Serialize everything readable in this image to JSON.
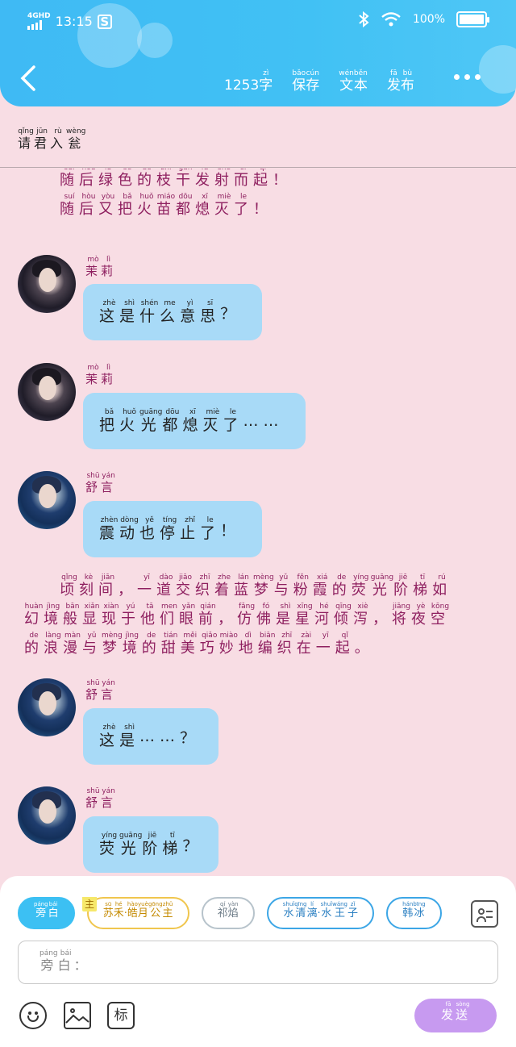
{
  "statusbar": {
    "network": "4GHD",
    "time": "13:15",
    "sim_icon": "S",
    "battery": "100%"
  },
  "header": {
    "word_count": "1253",
    "word_unit": {
      "char": "字",
      "py": "zì"
    },
    "save": [
      {
        "char": "保",
        "py": "bǎo"
      },
      {
        "char": "存",
        "py": "cún"
      }
    ],
    "text": [
      {
        "char": "文",
        "py": "wén"
      },
      {
        "char": "本",
        "py": "běn"
      }
    ],
    "publish": [
      {
        "char": "发",
        "py": "fā"
      },
      {
        "char": "布",
        "py": "bù"
      }
    ]
  },
  "title": [
    {
      "char": "请",
      "py": "qǐng"
    },
    {
      "char": "君",
      "py": "jūn"
    },
    {
      "char": "入",
      "py": "rù"
    },
    {
      "char": "瓮",
      "py": "wèng"
    }
  ],
  "messages": [
    {
      "type": "narration",
      "lines": [
        [
          [
            "随",
            "suí"
          ],
          [
            "后",
            "hòu"
          ],
          [
            "绿",
            "lǜ"
          ],
          [
            "色",
            "sè"
          ],
          [
            "的",
            "de"
          ],
          [
            "枝",
            "zhī"
          ],
          [
            "干",
            "gàn"
          ],
          [
            "发",
            "fā"
          ],
          [
            "射",
            "shè"
          ],
          [
            "而",
            "ér"
          ],
          [
            "起",
            "qǐ"
          ],
          [
            "！",
            ""
          ]
        ],
        [
          [
            "随",
            "suí"
          ],
          [
            "后",
            "hòu"
          ],
          [
            "又",
            "yòu"
          ],
          [
            "把",
            "bǎ"
          ],
          [
            "火",
            "huǒ"
          ],
          [
            "苗",
            "miáo"
          ],
          [
            "都",
            "dōu"
          ],
          [
            "熄",
            "xī"
          ],
          [
            "灭",
            "miè"
          ],
          [
            "了",
            "le"
          ],
          [
            "！",
            ""
          ]
        ]
      ]
    },
    {
      "type": "chat",
      "avatar": "moli",
      "sender": [
        [
          "茉",
          "mò"
        ],
        [
          "莉",
          "lì"
        ]
      ],
      "text": [
        [
          "这",
          "zhè"
        ],
        [
          "是",
          "shì"
        ],
        [
          "什",
          "shén"
        ],
        [
          "么",
          "me"
        ],
        [
          "意",
          "yì"
        ],
        [
          "思",
          "sī"
        ],
        [
          "？",
          ""
        ]
      ]
    },
    {
      "type": "chat",
      "avatar": "moli",
      "sender": [
        [
          "茉",
          "mò"
        ],
        [
          "莉",
          "lì"
        ]
      ],
      "text": [
        [
          "把",
          "bǎ"
        ],
        [
          "火",
          "huǒ"
        ],
        [
          "光",
          "guāng"
        ],
        [
          "都",
          "dōu"
        ],
        [
          "熄",
          "xī"
        ],
        [
          "灭",
          "miè"
        ],
        [
          "了",
          "le"
        ],
        [
          "……",
          ""
        ]
      ]
    },
    {
      "type": "chat",
      "avatar": "shu",
      "sender": [
        [
          "舒",
          "shū"
        ],
        [
          "言",
          "yán"
        ]
      ],
      "text": [
        [
          "震",
          "zhèn"
        ],
        [
          "动",
          "dòng"
        ],
        [
          "也",
          "yě"
        ],
        [
          "停",
          "tíng"
        ],
        [
          "止",
          "zhǐ"
        ],
        [
          "了",
          "le"
        ],
        [
          "！",
          ""
        ]
      ]
    },
    {
      "type": "narration",
      "lines": [
        [
          [
            "顷",
            "qǐng"
          ],
          [
            "刻",
            "kè"
          ],
          [
            "间",
            "jiān"
          ],
          [
            "，",
            ""
          ],
          [
            "一",
            "yī"
          ],
          [
            "道",
            "dào"
          ],
          [
            "交",
            "jiāo"
          ],
          [
            "织",
            "zhī"
          ],
          [
            "着",
            "zhe"
          ],
          [
            "蓝",
            "lán"
          ],
          [
            "梦",
            "mèng"
          ],
          [
            "与",
            "yǔ"
          ],
          [
            "粉",
            "fěn"
          ],
          [
            "霞",
            "xiá"
          ],
          [
            "的",
            "de"
          ],
          [
            "荧",
            "yíng"
          ],
          [
            "光",
            "guāng"
          ],
          [
            "阶",
            "jiē"
          ],
          [
            "梯",
            "tī"
          ],
          [
            "如",
            "rú"
          ]
        ],
        [
          [
            "幻",
            "huàn"
          ],
          [
            "境",
            "jìng"
          ],
          [
            "般",
            "bān"
          ],
          [
            "显",
            "xiǎn"
          ],
          [
            "现",
            "xiàn"
          ],
          [
            "于",
            "yú"
          ],
          [
            "他",
            "tā"
          ],
          [
            "们",
            "men"
          ],
          [
            "眼",
            "yǎn"
          ],
          [
            "前",
            "qián"
          ],
          [
            "，",
            ""
          ],
          [
            "仿",
            "fǎng"
          ],
          [
            "佛",
            "fó"
          ],
          [
            "是",
            "shì"
          ],
          [
            "星",
            "xīng"
          ],
          [
            "河",
            "hé"
          ],
          [
            "倾",
            "qīng"
          ],
          [
            "泻",
            "xiè"
          ],
          [
            "，",
            ""
          ],
          [
            "将",
            "jiāng"
          ],
          [
            "夜",
            "yè"
          ],
          [
            "空",
            "kōng"
          ]
        ],
        [
          [
            "的",
            "de"
          ],
          [
            "浪",
            "làng"
          ],
          [
            "漫",
            "màn"
          ],
          [
            "与",
            "yǔ"
          ],
          [
            "梦",
            "mèng"
          ],
          [
            "境",
            "jìng"
          ],
          [
            "的",
            "de"
          ],
          [
            "甜",
            "tián"
          ],
          [
            "美",
            "měi"
          ],
          [
            "巧",
            "qiǎo"
          ],
          [
            "妙",
            "miào"
          ],
          [
            "地",
            "dì"
          ],
          [
            "编",
            "biān"
          ],
          [
            "织",
            "zhī"
          ],
          [
            "在",
            "zài"
          ],
          [
            "一",
            "yī"
          ],
          [
            "起",
            "qǐ"
          ],
          [
            "。",
            ""
          ]
        ]
      ]
    },
    {
      "type": "chat",
      "avatar": "shu",
      "sender": [
        [
          "舒",
          "shū"
        ],
        [
          "言",
          "yán"
        ]
      ],
      "text": [
        [
          "这",
          "zhè"
        ],
        [
          "是",
          "shì"
        ],
        [
          "……",
          ""
        ],
        [
          "？",
          ""
        ]
      ]
    },
    {
      "type": "chat",
      "avatar": "shu",
      "sender": [
        [
          "舒",
          "shū"
        ],
        [
          "言",
          "yán"
        ]
      ],
      "text": [
        [
          "荧",
          "yíng"
        ],
        [
          "光",
          "guāng"
        ],
        [
          "阶",
          "jiē"
        ],
        [
          "梯",
          "tī"
        ],
        [
          "？",
          ""
        ]
      ]
    }
  ],
  "characters": [
    {
      "label": [
        [
          "旁",
          "páng"
        ],
        [
          "白",
          "bái"
        ]
      ],
      "style": "active"
    },
    {
      "label": [
        [
          "苏",
          "sū"
        ],
        [
          "禾",
          "hé"
        ],
        [
          "·",
          ""
        ],
        [
          "皓",
          "hào"
        ],
        [
          "月",
          "yuè"
        ],
        [
          "公",
          "gōng"
        ],
        [
          "主",
          "zhǔ"
        ]
      ],
      "style": "yellow",
      "tag": [
        [
          "主",
          "zhǔ"
        ]
      ]
    },
    {
      "label": [
        [
          "祁",
          "qí"
        ],
        [
          "焰",
          "yàn"
        ]
      ],
      "style": "gray"
    },
    {
      "label": [
        [
          "水",
          "shuǐ"
        ],
        [
          "清",
          "qīng"
        ],
        [
          "漓",
          "lí"
        ],
        [
          "·",
          ""
        ],
        [
          "水",
          "shuǐ"
        ],
        [
          "王",
          "wáng"
        ],
        [
          "子",
          "zǐ"
        ]
      ],
      "style": "blue"
    },
    {
      "label": [
        [
          "韩",
          "hán"
        ],
        [
          "冰",
          "bīng"
        ]
      ],
      "style": "blue"
    }
  ],
  "input": {
    "label": [
      [
        "旁",
        "páng"
      ],
      [
        "白",
        "bái"
      ],
      [
        "：",
        ""
      ]
    ]
  },
  "send": [
    [
      "发",
      "fā"
    ],
    [
      "送",
      "sòng"
    ]
  ],
  "tools": {
    "mark_label": "标"
  },
  "icons": [
    "back-chevron-icon",
    "more-dots-icon",
    "contact-card-icon",
    "emoji-icon",
    "image-icon",
    "mark-icon",
    "wifi-icon",
    "bluetooth-icon",
    "signal-icon",
    "battery-icon"
  ],
  "colors": {
    "header": "#3fbaf4",
    "background": "#f8dde4",
    "narration": "#8e1f5f",
    "bubble": "#a8daf7",
    "send": "#c79af0"
  }
}
